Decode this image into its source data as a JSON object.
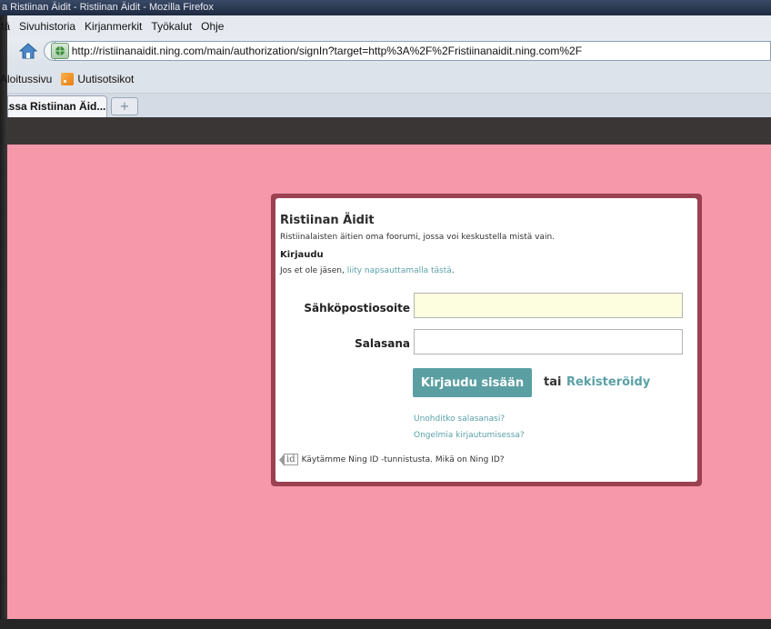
{
  "window": {
    "title": "a Ristiinan Äidit - Ristiinan Äidit - Mozilla Firefox"
  },
  "menubar": {
    "items": [
      "tä",
      "Sivuhistoria",
      "Kirjanmerkit",
      "Työkalut",
      "Ohje"
    ]
  },
  "navbar": {
    "url": "http://ristiinanaidit.ning.com/main/authorization/signIn?target=http%3A%2F%2Fristiinanaidit.ning.com%2F"
  },
  "bookmarks": {
    "items": [
      "Aloitussivu",
      "Uutisotsikot"
    ]
  },
  "tabs": {
    "active_label": "assa Ristiinan Äid...",
    "new_tab_symbol": "+"
  },
  "signin": {
    "site_title": "Ristiinan Äidit",
    "site_description": "Ristiinalaisten äitien oma foorumi, jossa voi keskustella mistä vain.",
    "heading": "Kirjaudu",
    "join_prefix": "Jos et ole jäsen, ",
    "join_link": "liity napsauttamalla tästä",
    "join_suffix": ".",
    "email_label": "Sähköpostiosoite",
    "email_value": "",
    "password_label": "Salasana",
    "password_value": "",
    "login_button": "Kirjaudu sisään",
    "or_text": "tai",
    "register_link": "Rekisteröidy",
    "forgot_link": "Unohditko salasanasi?",
    "problem_link": "Ongelmia kirjautumisessa?",
    "ningid_badge": "id",
    "ningid_text": "Käytämme Ning ID -tunnistusta. Mikä on Ning ID?"
  },
  "colors": {
    "page_background": "#f798aa",
    "box_border": "#9b4152",
    "accent_button": "#5b9fa2",
    "link": "#5aa0a8",
    "site_strip": "#3a3636"
  }
}
